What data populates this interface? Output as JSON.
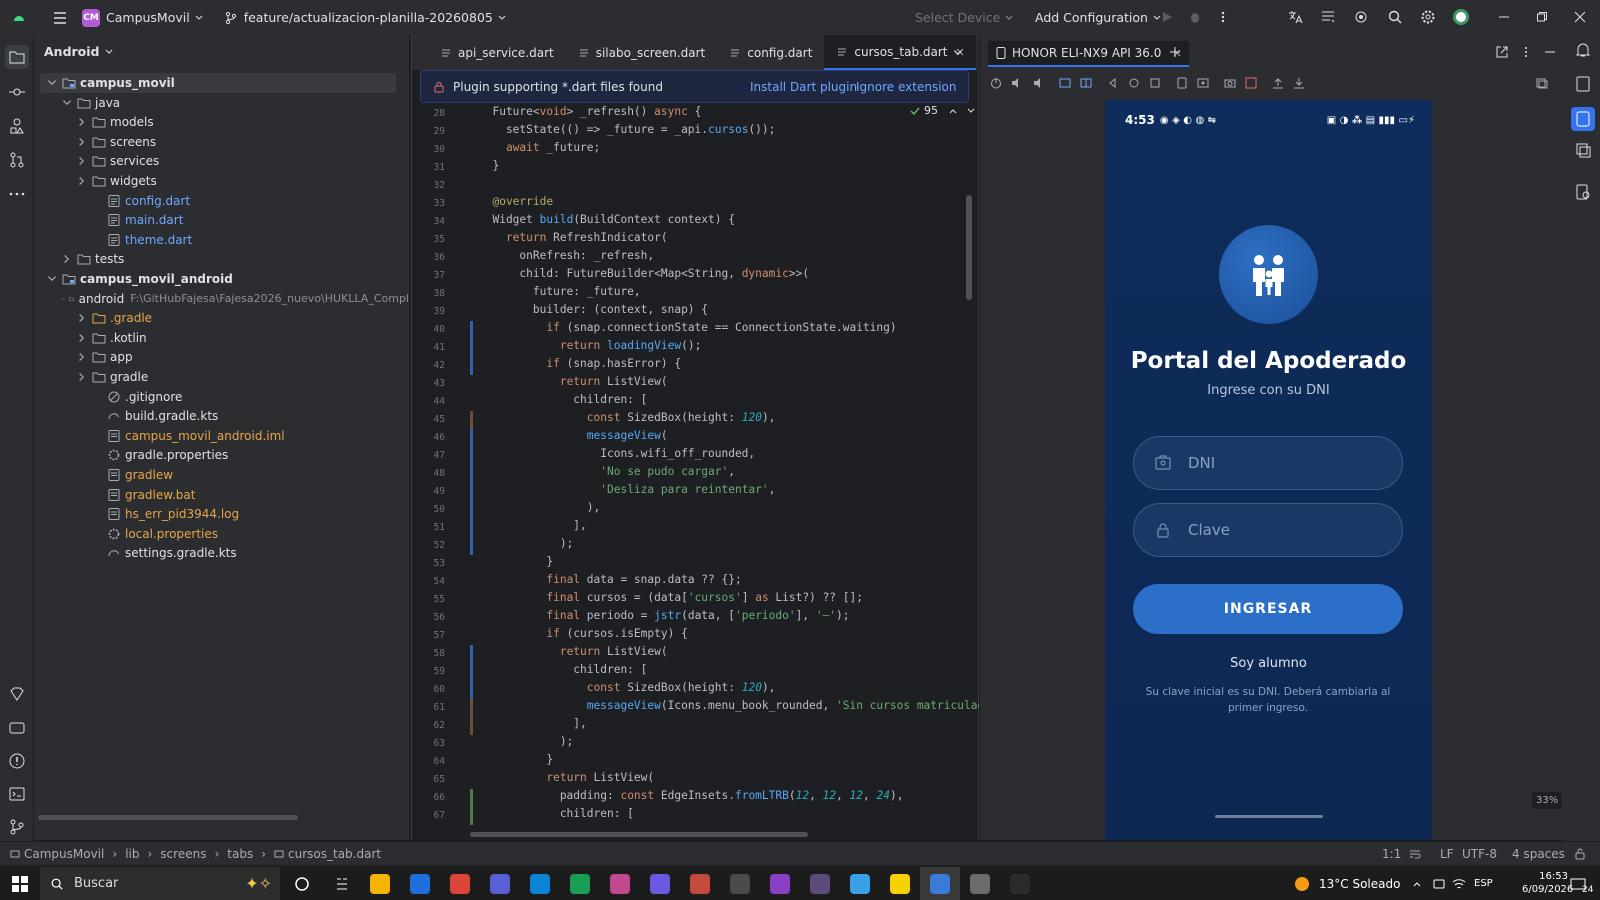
{
  "titlebar": {
    "project_badge": "CM",
    "project_name": "CampusMovil",
    "branch": "feature/actualizacion-planilla-20260805",
    "device": "Select Device",
    "config": "Add Configuration"
  },
  "project_panel": {
    "view_label": "Android",
    "rows": [
      {
        "label": "campus_movil",
        "indent": 0,
        "kind": "module",
        "expanded": true,
        "selected": true
      },
      {
        "label": "java",
        "indent": 1,
        "kind": "folder",
        "expanded": true
      },
      {
        "label": "models",
        "indent": 2,
        "kind": "folder",
        "expanded": false
      },
      {
        "label": "screens",
        "indent": 2,
        "kind": "folder",
        "expanded": false
      },
      {
        "label": "services",
        "indent": 2,
        "kind": "folder",
        "expanded": false
      },
      {
        "label": "widgets",
        "indent": 2,
        "kind": "folder",
        "expanded": false
      },
      {
        "label": "config.dart",
        "indent": 3,
        "kind": "dart"
      },
      {
        "label": "main.dart",
        "indent": 3,
        "kind": "dart"
      },
      {
        "label": "theme.dart",
        "indent": 3,
        "kind": "dart"
      },
      {
        "label": "tests",
        "indent": 1,
        "kind": "folder",
        "expanded": false
      },
      {
        "label": "campus_movil_android",
        "indent": 0,
        "kind": "module",
        "expanded": true
      },
      {
        "label": "android",
        "indent": 1,
        "kind": "folder",
        "expanded": true,
        "extra": "F:\\GitHubFajesa\\Fajesa2026_nuevo\\HUKLLA_Compl"
      },
      {
        "label": ".gradle",
        "indent": 2,
        "kind": "folder-orange",
        "expanded": false
      },
      {
        "label": ".kotlin",
        "indent": 2,
        "kind": "folder",
        "expanded": false
      },
      {
        "label": "app",
        "indent": 2,
        "kind": "folder",
        "expanded": false
      },
      {
        "label": "gradle",
        "indent": 2,
        "kind": "folder",
        "expanded": false
      },
      {
        "label": ".gitignore",
        "indent": 3,
        "kind": "ignore"
      },
      {
        "label": "build.gradle.kts",
        "indent": 3,
        "kind": "gradle"
      },
      {
        "label": "campus_movil_android.iml",
        "indent": 3,
        "kind": "orange-file"
      },
      {
        "label": "gradle.properties",
        "indent": 3,
        "kind": "gear"
      },
      {
        "label": "gradlew",
        "indent": 3,
        "kind": "orange-file"
      },
      {
        "label": "gradlew.bat",
        "indent": 3,
        "kind": "orange-file"
      },
      {
        "label": "hs_err_pid3944.log",
        "indent": 3,
        "kind": "orange-file"
      },
      {
        "label": "local.properties",
        "indent": 3,
        "kind": "orange-gear"
      },
      {
        "label": "settings.gradle.kts",
        "indent": 3,
        "kind": "gradle"
      }
    ]
  },
  "editor": {
    "tabs": [
      "api_service.dart",
      "silabo_screen.dart",
      "config.dart",
      "cursos_tab.dart"
    ],
    "active_tab": "cursos_tab.dart",
    "banner": {
      "message": "Plugin supporting *.dart files found",
      "install": "Install Dart plugin",
      "ignore": "Ignore extension"
    },
    "inspection_count": "95",
    "lines": [
      {
        "n": "28",
        "code": "  Future<void> _refresh() async {"
      },
      {
        "n": "29",
        "code": "    setState(() => _future = _api.cursos());"
      },
      {
        "n": "30",
        "code": "    await _future;"
      },
      {
        "n": "31",
        "code": "  }"
      },
      {
        "n": "32",
        "code": ""
      },
      {
        "n": "33",
        "code": "  @override"
      },
      {
        "n": "34",
        "code": "  Widget build(BuildContext context) {"
      },
      {
        "n": "35",
        "code": "    return RefreshIndicator("
      },
      {
        "n": "36",
        "code": "      onRefresh: _refresh,"
      },
      {
        "n": "37",
        "code": "      child: FutureBuilder<Map<String, dynamic>>("
      },
      {
        "n": "38",
        "code": "        future: _future,"
      },
      {
        "n": "39",
        "code": "        builder: (context, snap) {"
      },
      {
        "n": "40",
        "code": "          if (snap.connectionState == ConnectionState.waiting)"
      },
      {
        "n": "41",
        "code": "            return loadingView();"
      },
      {
        "n": "42",
        "code": "          if (snap.hasError) {"
      },
      {
        "n": "43",
        "code": "            return ListView("
      },
      {
        "n": "44",
        "code": "              children: ["
      },
      {
        "n": "45",
        "code": "                const SizedBox(height: 120),"
      },
      {
        "n": "46",
        "code": "                messageView("
      },
      {
        "n": "47",
        "code": "                  Icons.wifi_off_rounded,"
      },
      {
        "n": "48",
        "code": "                  'No se pudo cargar',"
      },
      {
        "n": "49",
        "code": "                  'Desliza para reintentar',"
      },
      {
        "n": "50",
        "code": "                ),"
      },
      {
        "n": "51",
        "code": "              ],"
      },
      {
        "n": "52",
        "code": "            );"
      },
      {
        "n": "53",
        "code": "          }"
      },
      {
        "n": "54",
        "code": "          final data = snap.data ?? {};"
      },
      {
        "n": "55",
        "code": "          final cursos = (data['cursos'] as List?) ?? [];"
      },
      {
        "n": "56",
        "code": "          final periodo = jstr(data, ['periodo'], '—');"
      },
      {
        "n": "57",
        "code": "          if (cursos.isEmpty) {"
      },
      {
        "n": "58",
        "code": "            return ListView("
      },
      {
        "n": "59",
        "code": "              children: ["
      },
      {
        "n": "60",
        "code": "                const SizedBox(height: 120),"
      },
      {
        "n": "61",
        "code": "                messageView(Icons.menu_book_rounded, 'Sin cursos matriculad"
      },
      {
        "n": "62",
        "code": "              ],"
      },
      {
        "n": "63",
        "code": "            );"
      },
      {
        "n": "64",
        "code": "          }"
      },
      {
        "n": "65",
        "code": "          return ListView("
      },
      {
        "n": "66",
        "code": "            padding: const EdgeInsets.fromLTRB(12, 12, 12, 24),"
      },
      {
        "n": "67",
        "code": "            children: ["
      }
    ]
  },
  "running_devices": {
    "tab_label": "HONOR ELI-NX9 API 36.0",
    "zoom": "33%",
    "phone": {
      "time": "4:53",
      "title": "Portal del Apoderado",
      "subtitle": "Ingrese con su DNI",
      "dni_placeholder": "DNI",
      "password_placeholder": "Clave",
      "login_button": "INGRESAR",
      "student_link": "Soy alumno",
      "hint": "Su clave inicial es su DNI. Deberá cambiarla al primer ingreso."
    }
  },
  "breadcrumb": {
    "items": [
      "CampusMovil",
      "lib",
      "screens",
      "tabs",
      "cursos_tab.dart"
    ],
    "position": "1:1",
    "line_sep": "LF",
    "encoding": "UTF-8",
    "indent": "4 spaces"
  },
  "taskbar": {
    "search": "Buscar",
    "weather": "13°C Soleado",
    "lang": "ESP",
    "time": "16:53",
    "date": "6/09/2026",
    "notif": "24"
  },
  "colors": {
    "accent": "#3574f0",
    "phone_bg": "#0f2d5c",
    "phone_button": "#2c6fc9"
  }
}
